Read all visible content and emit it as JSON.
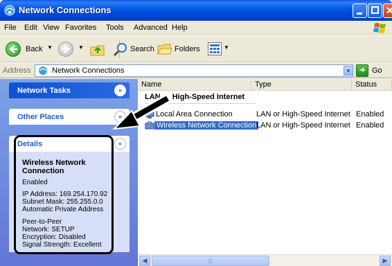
{
  "window": {
    "title": "Network Connections"
  },
  "menu": [
    "File",
    "Edit",
    "View",
    "Favorites",
    "Tools",
    "Advanced",
    "Help"
  ],
  "toolbar": {
    "back_label": "Back",
    "search_label": "Search",
    "folders_label": "Folders"
  },
  "address": {
    "label": "Address",
    "value": "Network Connections",
    "go_label": "Go"
  },
  "sidebar": {
    "network_tasks": "Network Tasks",
    "other_places": "Other Places",
    "details": {
      "title": "Details",
      "name": "Wireless Network Connection",
      "status": "Enabled",
      "ip": "IP Address: 169.254.170.92",
      "subnet": "Subnet Mask: 255.255.0.0",
      "assign": "Automatic Private Address",
      "mode": "Peer-to-Peer",
      "network": "Network: SETUP",
      "encryption": "Encryption: Disabled",
      "signal": "Signal Strength: Excellent"
    }
  },
  "list": {
    "columns": [
      "Name",
      "Type",
      "Status"
    ],
    "group": "LAN or High-Speed Internet",
    "rows": [
      {
        "name": "Local Area Connection",
        "type": "LAN or High-Speed Internet",
        "status": "Enabled",
        "selected": false
      },
      {
        "name": "Wireless Network Connection",
        "type": "LAN or High-Speed Internet",
        "status": "Enabled",
        "selected": true
      }
    ]
  },
  "colors": {
    "titlebar": "#0055e5",
    "sidebar": "#7ba2e7",
    "selection": "#316ac5",
    "details_body": "#d6dff7"
  }
}
